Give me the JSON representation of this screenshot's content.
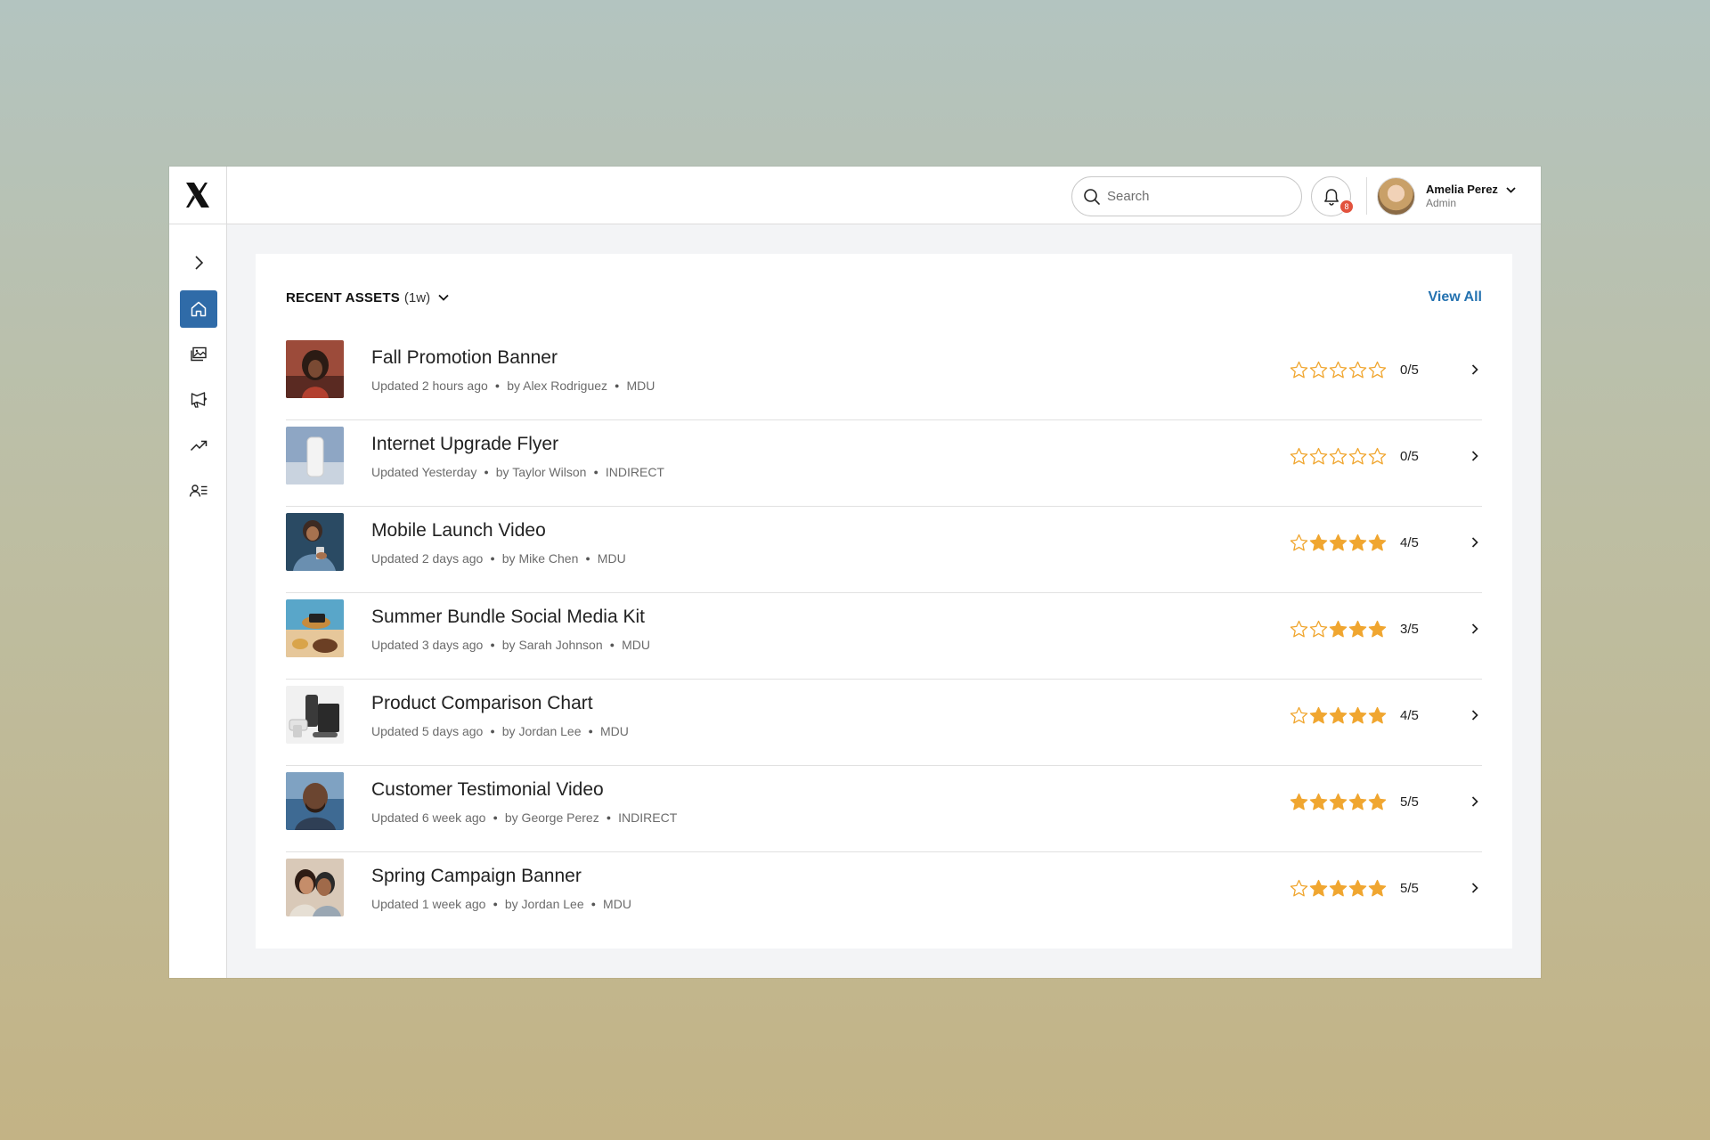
{
  "header": {
    "search_placeholder": "Search",
    "notification_count": "8",
    "user": {
      "name": "Amelia Perez",
      "role": "Admin"
    }
  },
  "colors": {
    "accent": "#2f6ba8",
    "link": "#2472b0",
    "star": "#f0a630",
    "badge": "#e2523d"
  },
  "sidebar": {
    "items": [
      {
        "name": "expand",
        "icon": "chevron-right-icon",
        "active": false
      },
      {
        "name": "home",
        "icon": "home-icon",
        "active": true
      },
      {
        "name": "assets",
        "icon": "image-gallery-icon",
        "active": false
      },
      {
        "name": "campaigns",
        "icon": "megaphone-icon",
        "active": false
      },
      {
        "name": "analytics",
        "icon": "trending-up-icon",
        "active": false
      },
      {
        "name": "users",
        "icon": "user-list-icon",
        "active": false
      }
    ]
  },
  "recent": {
    "title": "RECENT ASSETS",
    "period": "(1w)",
    "view_all": "View All",
    "items": [
      {
        "title": "Fall Promotion Banner",
        "updated": "Updated 2 hours ago",
        "author": "by Alex Rodriguez",
        "channel": "MDU",
        "rating": 0,
        "score": "0/5",
        "thumb": "woman-portrait"
      },
      {
        "title": "Internet Upgrade Flyer",
        "updated": "Updated Yesterday",
        "author": "by Taylor Wilson",
        "channel": "INDIRECT",
        "rating": 0,
        "score": "0/5",
        "thumb": "router"
      },
      {
        "title": "Mobile Launch Video",
        "updated": "Updated 2 days ago",
        "author": "by Mike Chen",
        "channel": "MDU",
        "rating": 4,
        "score": "4/5",
        "thumb": "phone-user"
      },
      {
        "title": "Summer Bundle Social Media Kit",
        "updated": "Updated 3 days ago",
        "author": "by Sarah Johnson",
        "channel": "MDU",
        "rating": 3,
        "score": "3/5",
        "thumb": "beach"
      },
      {
        "title": "Product Comparison Chart",
        "updated": "Updated 5 days ago",
        "author": "by Jordan Lee",
        "channel": "MDU",
        "rating": 4,
        "score": "4/5",
        "thumb": "devices"
      },
      {
        "title": "Customer Testimonial Video",
        "updated": "Updated 6 week ago",
        "author": "by George Perez",
        "channel": "INDIRECT",
        "rating": 5,
        "score": "5/5",
        "thumb": "man-portrait"
      },
      {
        "title": "Spring Campaign Banner",
        "updated": "Updated 1 week ago",
        "author": "by Jordan Lee",
        "channel": "MDU",
        "rating": 4,
        "score": "5/5",
        "thumb": "couple"
      }
    ]
  }
}
